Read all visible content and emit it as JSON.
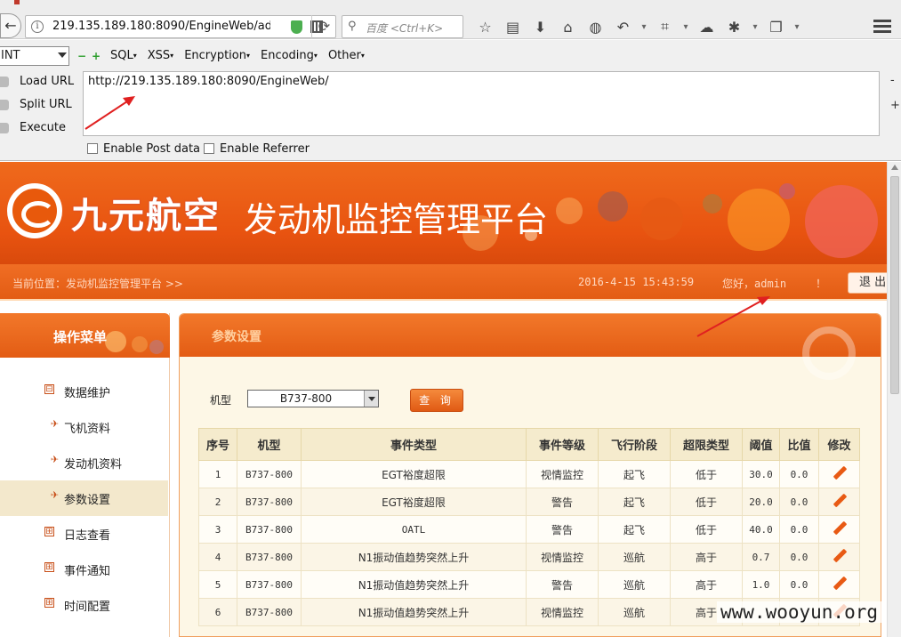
{
  "browser": {
    "url": "219.135.189.180:8090/EngineWeb/adı",
    "search_placeholder": "百度 <Ctrl+K>"
  },
  "hackbar": {
    "int_select": "INT",
    "menus": [
      "SQL",
      "XSS",
      "Encryption",
      "Encoding",
      "Other"
    ],
    "load_url": "Load URL",
    "split_url": "Split URL",
    "execute": "Execute",
    "url_text": "http://219.135.189.180:8090/EngineWeb/",
    "enable_post": "Enable Post data",
    "enable_referrer": "Enable Referrer",
    "side_minus": "-",
    "side_plus": "+"
  },
  "site": {
    "logo_text": "九元航空",
    "title": "发动机监控管理平台",
    "location": "当前位置：发动机监控管理平台 >>",
    "datetime": "2016-4-15 15:43:59",
    "greeting_prefix": "您好，",
    "username": "admin",
    "greeting_suffix": "！",
    "logout": "退 出"
  },
  "menu": {
    "title": "操作菜单",
    "items": [
      {
        "label": "数据维护",
        "icon": "⊟"
      },
      {
        "label": "飞机资料",
        "icon": "✈"
      },
      {
        "label": "发动机资料",
        "icon": "✈"
      },
      {
        "label": "参数设置",
        "icon": "✈"
      },
      {
        "label": "日志查看",
        "icon": "⊞"
      },
      {
        "label": "事件通知",
        "icon": "⊞"
      },
      {
        "label": "时间配置",
        "icon": "⊞"
      }
    ]
  },
  "main": {
    "title": "参数设置",
    "filter_label": "机型",
    "model_value": "B737-800",
    "query_button": "查 询",
    "columns": [
      "序号",
      "机型",
      "事件类型",
      "事件等级",
      "飞行阶段",
      "超限类型",
      "阈值",
      "比值",
      "修改"
    ],
    "rows": [
      [
        "1",
        "B737-800",
        "EGT裕度超限",
        "视情监控",
        "起飞",
        "低于",
        "30.0",
        "0.0"
      ],
      [
        "2",
        "B737-800",
        "EGT裕度超限",
        "警告",
        "起飞",
        "低于",
        "20.0",
        "0.0"
      ],
      [
        "3",
        "B737-800",
        "OATL",
        "警告",
        "起飞",
        "低于",
        "40.0",
        "0.0"
      ],
      [
        "4",
        "B737-800",
        "N1振动值趋势突然上升",
        "视情监控",
        "巡航",
        "高于",
        "0.7",
        "0.0"
      ],
      [
        "5",
        "B737-800",
        "N1振动值趋势突然上升",
        "警告",
        "巡航",
        "高于",
        "1.0",
        "0.0"
      ],
      [
        "6",
        "B737-800",
        "N1振动值趋势突然上升",
        "视情监控",
        "巡航",
        "高于",
        "",
        ""
      ]
    ]
  },
  "watermark": "www.wooyun.org",
  "colors": {
    "accent": "#e85a14",
    "table_header": "#f5ebcd"
  }
}
